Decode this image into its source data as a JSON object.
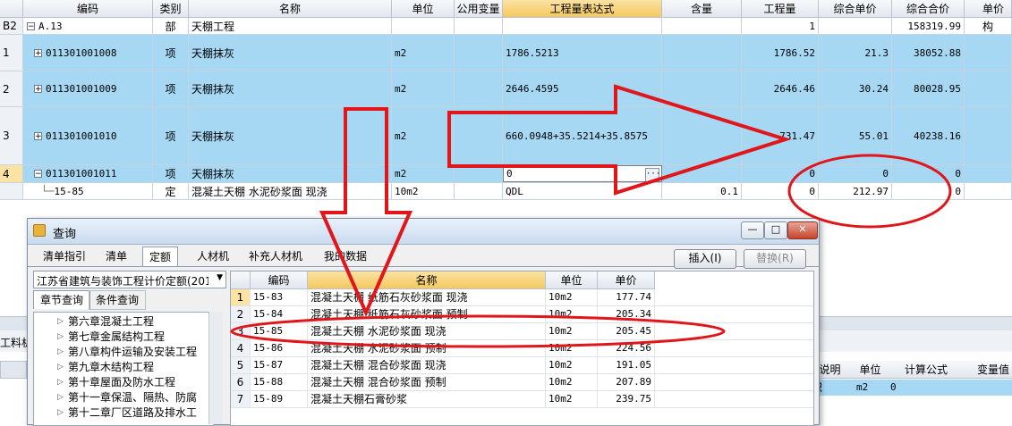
{
  "main_grid": {
    "columns": [
      "编码",
      "类别",
      "名称",
      "单位",
      "公用变量",
      "工程量表达式",
      "含量",
      "工程量",
      "综合单价",
      "综合合价",
      "单价构"
    ],
    "rows": [
      {
        "idx": "B2",
        "toggle": "−",
        "code": "A.13",
        "type": "部",
        "name": "天棚工程",
        "unit": "",
        "expr": "",
        "content": "",
        "qty": "1",
        "unit_price": "",
        "total": "158319.99",
        "selected": false
      },
      {
        "idx": "1",
        "toggle": "+",
        "code": "011301001008",
        "type": "项",
        "name": "天棚抹灰",
        "unit": "m2",
        "expr": "1786.5213",
        "content": "",
        "qty": "1786.52",
        "unit_price": "21.3",
        "total": "38052.88",
        "selected": true
      },
      {
        "idx": "2",
        "toggle": "+",
        "code": "011301001009",
        "type": "项",
        "name": "天棚抹灰",
        "unit": "m2",
        "expr": "2646.4595",
        "content": "",
        "qty": "2646.46",
        "unit_price": "30.24",
        "total": "80028.95",
        "selected": true
      },
      {
        "idx": "3",
        "toggle": "+",
        "code": "011301001010",
        "type": "项",
        "name": "天棚抹灰",
        "unit": "m2",
        "expr": "660.0948+35.5214+35.8575",
        "content": "",
        "qty": "731.47",
        "unit_price": "55.01",
        "total": "40238.16",
        "selected": true
      },
      {
        "idx": "4",
        "toggle": "−",
        "code": "011301001011",
        "type": "项",
        "name": "天棚抹灰",
        "unit": "m2",
        "expr": "0",
        "content": "",
        "qty": "0",
        "unit_price": "0",
        "total": "0",
        "selected": true
      },
      {
        "idx": "",
        "toggle": "",
        "code": "15-85",
        "type": "定",
        "name": "混凝土天棚 水泥砂浆面 现浇",
        "unit": "10m2",
        "expr": "QDL",
        "content": "0.1",
        "qty": "0",
        "unit_price": "212.97",
        "total": "0",
        "selected": false
      }
    ]
  },
  "bg_panel": {
    "left_label": "工料机",
    "cols": [
      "说明",
      "单位",
      "计算公式",
      "变量值"
    ],
    "row": {
      "name": "积",
      "unit": "m2",
      "formula": "0"
    }
  },
  "dialog": {
    "title": "查询",
    "tabs": [
      "清单指引",
      "清单",
      "定额",
      "人材机",
      "补充人材机",
      "我的数据"
    ],
    "active_tab": "定额",
    "insert_label": "插入(I)",
    "replace_label": "替换(R)",
    "library": "江苏省建筑与装饰工程计价定额(201",
    "subtabs": [
      "章节查询",
      "条件查询"
    ],
    "tree": [
      "第六章混凝土工程",
      "第七章金属结构工程",
      "第八章构件运输及安装工程",
      "第九章木结构工程",
      "第十章屋面及防水工程",
      "第十一章保温、隔热、防腐",
      "第十二章厂区道路及排水工"
    ],
    "result_columns": [
      "编码",
      "名称",
      "单位",
      "单价"
    ],
    "results": [
      {
        "i": "1",
        "code": "15-83",
        "name": "混凝土天棚 纸筋石灰砂浆面 现浇",
        "unit": "10m2",
        "price": "177.74"
      },
      {
        "i": "2",
        "code": "15-84",
        "name": "混凝土天棚 纸筋石灰砂浆面 预制",
        "unit": "10m2",
        "price": "205.34"
      },
      {
        "i": "3",
        "code": "15-85",
        "name": "混凝土天棚 水泥砂浆面 现浇",
        "unit": "10m2",
        "price": "205.45"
      },
      {
        "i": "4",
        "code": "15-86",
        "name": "混凝土天棚 水泥砂浆面 预制",
        "unit": "10m2",
        "price": "224.56"
      },
      {
        "i": "5",
        "code": "15-87",
        "name": "混凝土天棚 混合砂浆面 现浇",
        "unit": "10m2",
        "price": "191.05"
      },
      {
        "i": "6",
        "code": "15-88",
        "name": "混凝土天棚 混合砂浆面 预制",
        "unit": "10m2",
        "price": "207.89"
      },
      {
        "i": "7",
        "code": "15-89",
        "name": "混凝土天棚石膏砂浆",
        "unit": "10m2",
        "price": "239.75"
      }
    ]
  },
  "colors": {
    "selected_row": "#a6d8f4",
    "highlight_header": "#f4c85e",
    "annotation": "#e0161b"
  }
}
